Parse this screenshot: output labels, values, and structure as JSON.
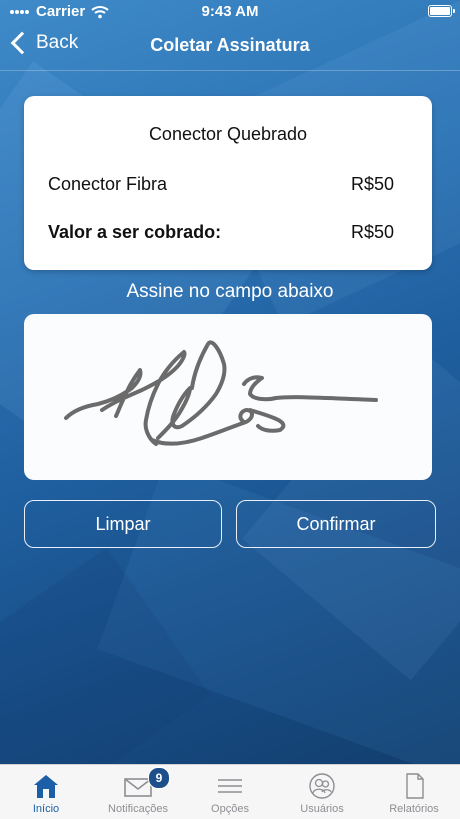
{
  "status_bar": {
    "carrier": "Carrier",
    "time": "9:43 AM"
  },
  "nav": {
    "back_label": "Back",
    "title": "Coletar Assinatura"
  },
  "summary": {
    "title": "Conector Quebrado",
    "items": [
      {
        "label": "Conector Fibra",
        "value": "R$50"
      }
    ],
    "total_label": "Valor a ser cobrado:",
    "total_value": "R$50"
  },
  "signature": {
    "hint": "Assine no campo abaixo",
    "stroke_color": "#6b6b6b"
  },
  "actions": {
    "clear_label": "Limpar",
    "confirm_label": "Confirmar"
  },
  "tabbar": {
    "active_color": "#1c5fa8",
    "tabs": [
      {
        "label": "Início",
        "icon": "home-icon",
        "active": true
      },
      {
        "label": "Notificações",
        "icon": "mail-icon",
        "badge": "9"
      },
      {
        "label": "Opções",
        "icon": "menu-icon"
      },
      {
        "label": "Usuários",
        "icon": "users-icon"
      },
      {
        "label": "Relatórios",
        "icon": "document-icon"
      }
    ]
  }
}
